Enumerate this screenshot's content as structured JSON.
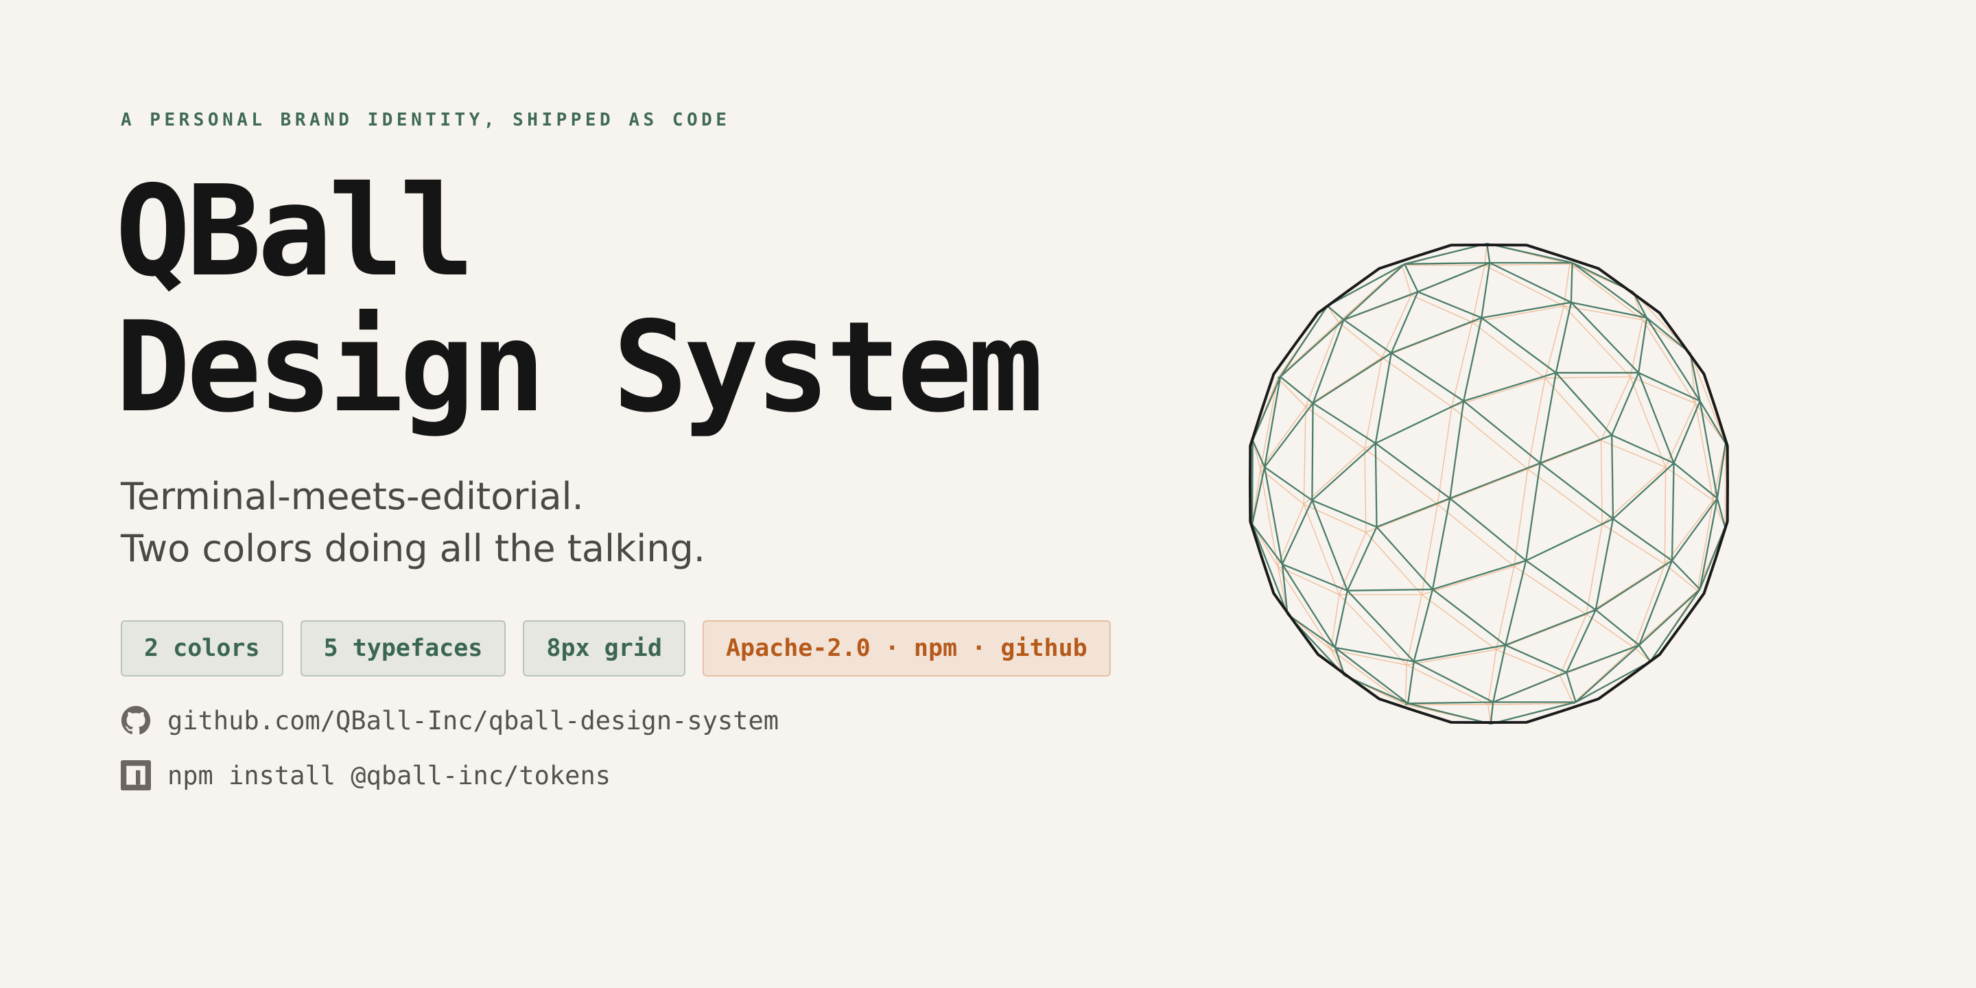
{
  "hero": {
    "eyebrow": "A PERSONAL BRAND IDENTITY, SHIPPED AS CODE",
    "title_line1": "QBall",
    "title_line2": "Design System",
    "tagline_line1": "Terminal-meets-editorial.",
    "tagline_line2": "Two colors doing all the talking."
  },
  "chips": [
    {
      "label": "2 colors",
      "style": "neutral"
    },
    {
      "label": "5 typefaces",
      "style": "neutral"
    },
    {
      "label": "8px grid",
      "style": "neutral"
    },
    {
      "label": "Apache-2.0 · npm · github",
      "style": "accent"
    }
  ],
  "links": [
    {
      "icon": "github-icon",
      "text": "github.com/QBall-Inc/qball-design-system"
    },
    {
      "icon": "npm-icon",
      "text": "npm install @qball-inc/tokens"
    }
  ],
  "colors": {
    "background": "#f7f4ef",
    "ink": "#151515",
    "primary_green": "#3f6a59",
    "accent_orange": "#b65a1a",
    "chip_bg": "#e6e7e0",
    "chip_accent_bg": "#f3e3d7"
  },
  "illustration": {
    "icon": "geodesic-sphere-icon"
  }
}
